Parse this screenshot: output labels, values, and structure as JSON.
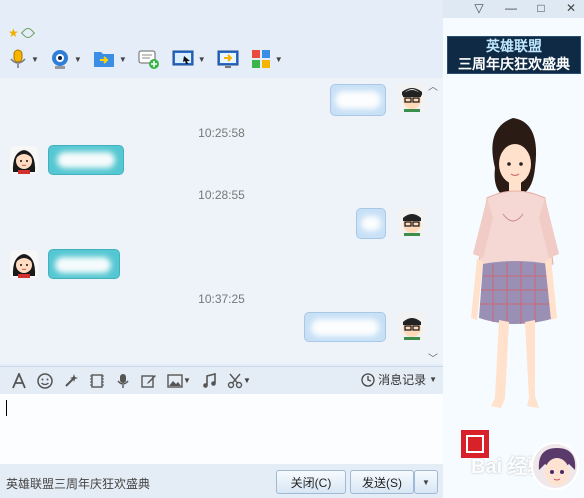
{
  "window": {
    "controls": [
      "▽",
      "—",
      "□",
      "✕"
    ]
  },
  "chat": {
    "timestamps": [
      "10:25:58",
      "10:28:55",
      "10:37:25"
    ]
  },
  "input_toolbar": {
    "history_label": "消息记录"
  },
  "bottom": {
    "ad_text": "英雄联盟三周年庆狂欢盛典",
    "close_label": "关闭(C)",
    "send_label": "发送(S)"
  },
  "side_panel": {
    "banner_line1": "英雄联盟",
    "banner_line2": "三周年庆狂欢盛典",
    "watermark": "Bai 经验"
  },
  "colors": {
    "accent": "#2f7fd8",
    "bubble_other": "#55c7d2",
    "bubble_me": "#c7e0f6"
  }
}
